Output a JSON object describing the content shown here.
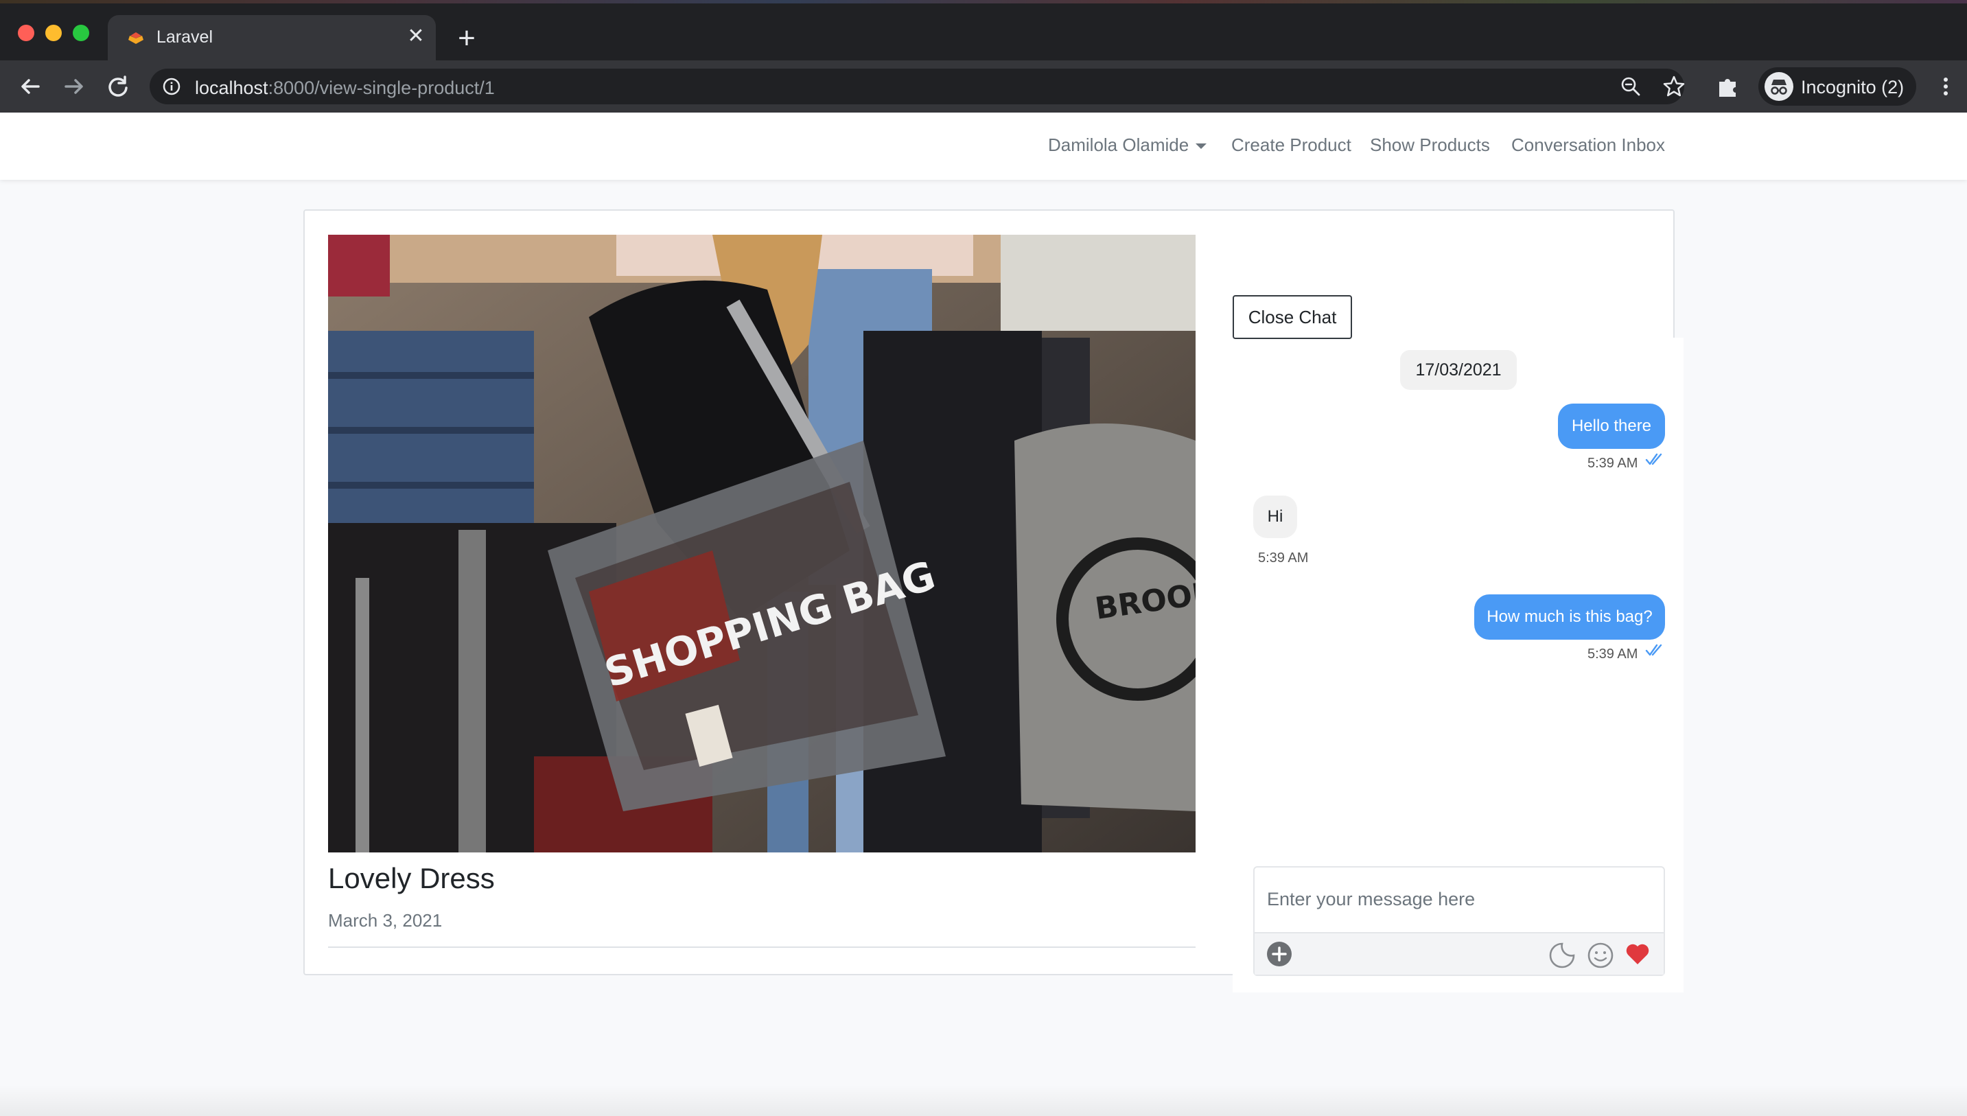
{
  "browser": {
    "tab": {
      "title": "Laravel",
      "favicon": "laravel-icon"
    },
    "url": {
      "host": "localhost",
      "rest": ":8000/view-single-product/1"
    },
    "incognito_label": "Incognito (2)",
    "icons": [
      "back-arrow-icon",
      "forward-arrow-icon",
      "reload-icon",
      "info-icon",
      "zoom-icon",
      "star-icon",
      "puzzle-icon",
      "incognito-icon",
      "kebab-menu-icon"
    ]
  },
  "navbar": {
    "user": "Damilola Olamide",
    "links": [
      "Create Product",
      "Show Products",
      "Conversation Inbox"
    ]
  },
  "product": {
    "title": "Lovely Dress",
    "date": "March 3, 2021",
    "image_text": "SHOPPING BAG"
  },
  "chat": {
    "close_label": "Close Chat",
    "date": "17/03/2021",
    "messages": [
      {
        "direction": "out",
        "text": "Hello there",
        "time": "5:39 AM"
      },
      {
        "direction": "in",
        "text": "Hi",
        "time": "5:39 AM"
      },
      {
        "direction": "out",
        "text": "How much is this bag?",
        "time": "5:39 AM"
      }
    ],
    "composer": {
      "placeholder": "Enter your message here",
      "icons": [
        "add-circle-icon",
        "sticker-icon",
        "emoji-icon",
        "heart-icon"
      ]
    }
  },
  "colors": {
    "accent_bubble": "#4a9af5",
    "heart": "#e0393e",
    "read_ticks": "#4a9af5"
  }
}
